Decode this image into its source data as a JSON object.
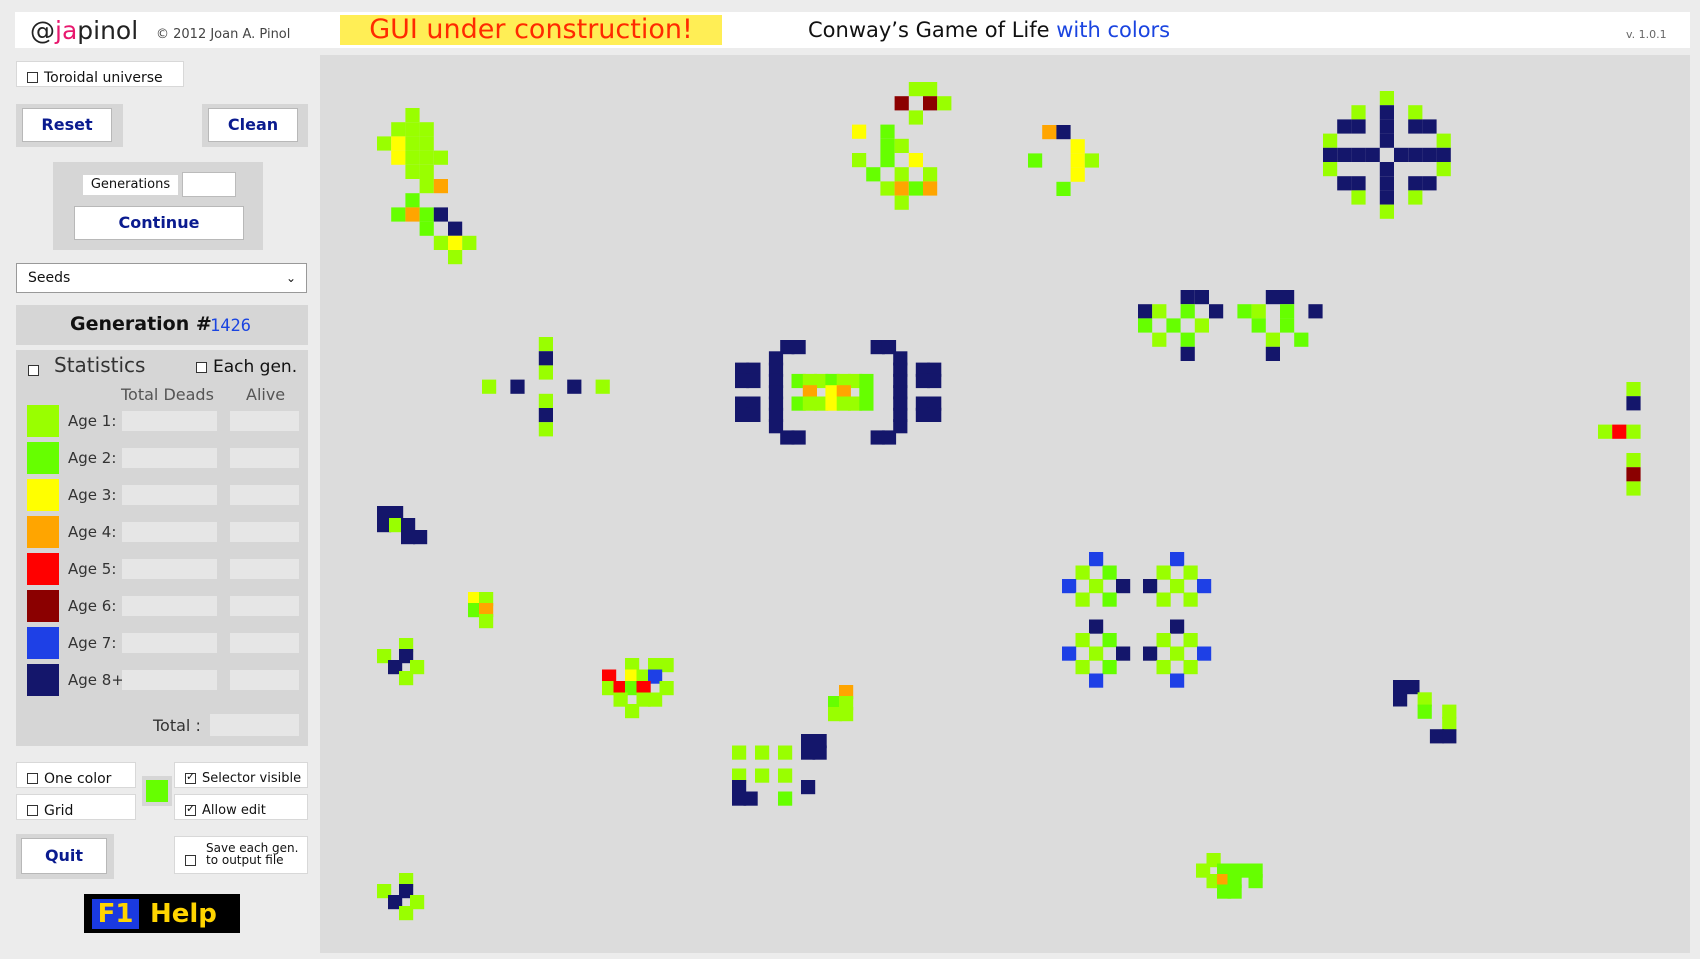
{
  "header": {
    "brand_at": "@",
    "brand_ja": "ja",
    "brand_rest": "pinol",
    "copyright": "© 2012 Joan A. Pinol",
    "construction": "GUI under construction!",
    "title_main": "Conway’s  Game of Life",
    "title_colors": "with colors",
    "version": "v. 1.0.1"
  },
  "controls": {
    "toroidal_label": "Toroidal universe",
    "reset_label": "Reset",
    "clean_label": "Clean",
    "generations_label": "Generations",
    "generations_value": "",
    "continue_label": "Continue",
    "preset_selected": "Seeds",
    "one_color_label": "One color",
    "grid_label": "Grid",
    "selector_visible_label": "Selector visible",
    "allow_edit_label": "Allow edit",
    "quit_label": "Quit",
    "save_line1": "Save each gen.",
    "save_line2": "to output file",
    "help_key": "F1",
    "help_label": "Help"
  },
  "generation": {
    "label": "Generation #",
    "number": "1426"
  },
  "statistics": {
    "title": "Statistics",
    "each_gen": "Each gen.",
    "col_deads": "Total Deads",
    "col_alive": "Alive",
    "total_label": "Total :",
    "ages": [
      {
        "label": "Age 1:",
        "color": "#99ff00"
      },
      {
        "label": "Age 2:",
        "color": "#66ff00"
      },
      {
        "label": "Age 3:",
        "color": "#ffff00"
      },
      {
        "label": "Age 4:",
        "color": "#ffa500"
      },
      {
        "label": "Age 5:",
        "color": "#ff0000"
      },
      {
        "label": "Age 6:",
        "color": "#8b0000"
      },
      {
        "label": "Age 7:",
        "color": "#1e40e6"
      },
      {
        "label": "Age 8+",
        "color": "#14166b"
      }
    ]
  },
  "state": {
    "toroidal": false,
    "statistics": false,
    "each_gen": false,
    "one_color": false,
    "grid": false,
    "selector_visible": true,
    "allow_edit": true,
    "save_each_gen": false,
    "one_color_swatch": "#66ff00"
  },
  "board": {
    "background": "#dcdcdc",
    "colors": {
      "1": "#99ff00",
      "2": "#66ff00",
      "3": "#ffff00",
      "4": "#ffa500",
      "5": "#ff0000",
      "6": "#8b0000",
      "7": "#1e40e6",
      "8": "#14166b"
    }
  }
}
